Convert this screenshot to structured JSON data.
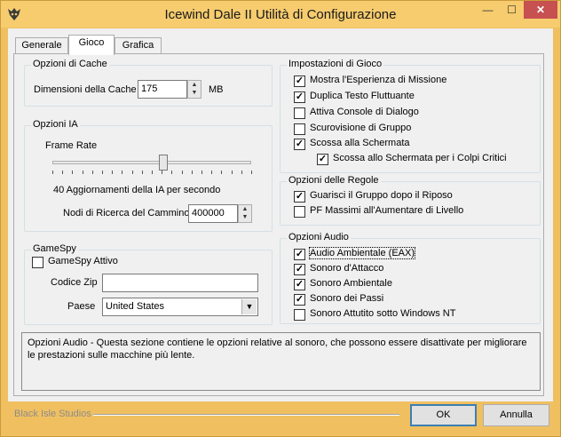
{
  "window": {
    "title": "Icewind Dale II Utilità di Configurazione"
  },
  "titlebar": {
    "minimize": "—",
    "maximize": "☐",
    "close": "✕"
  },
  "tabs": [
    {
      "label": "Generale",
      "active": false
    },
    {
      "label": "Gioco",
      "active": true
    },
    {
      "label": "Grafica",
      "active": false
    }
  ],
  "cache": {
    "title": "Opzioni di Cache",
    "size_label": "Dimensioni della Cache",
    "size_value": "175",
    "unit": "MB"
  },
  "ai": {
    "title": "Opzioni IA",
    "frame_rate_label": "Frame Rate",
    "updates_text": "40 Aggiornamenti della IA per secondo",
    "slider_fraction": 0.56,
    "pathfind_label": "Nodi di Ricerca del Cammino",
    "pathfind_value": "400000"
  },
  "gamespy": {
    "title": "GameSpy",
    "enabled_label": "GameSpy Attivo",
    "enabled": false,
    "zip_label": "Codice Zip",
    "zip_value": "",
    "country_label": "Paese",
    "country_value": "United States"
  },
  "game_settings": {
    "title": "Impostazioni di Gioco",
    "items": [
      {
        "label": "Mostra l'Esperienza di Missione",
        "checked": true
      },
      {
        "label": "Duplica Testo Fluttuante",
        "checked": true
      },
      {
        "label": "Attiva Console di Dialogo",
        "checked": false
      },
      {
        "label": "Scurovisione di Gruppo",
        "checked": false
      },
      {
        "label": "Scossa alla Schermata",
        "checked": true
      },
      {
        "label": "Scossa allo Schermata per i Colpi Critici",
        "checked": true
      }
    ]
  },
  "rules": {
    "title": "Opzioni delle Regole",
    "items": [
      {
        "label": "Guarisci il Gruppo dopo il Riposo",
        "checked": true
      },
      {
        "label": "PF Massimi all'Aumentare di Livello",
        "checked": false
      }
    ]
  },
  "audio": {
    "title": "Opzioni Audio",
    "items": [
      {
        "label": "Audio Ambientale (EAX)",
        "checked": true
      },
      {
        "label": "Sonoro d'Attacco",
        "checked": true
      },
      {
        "label": "Sonoro Ambientale",
        "checked": true
      },
      {
        "label": "Sonoro dei Passi",
        "checked": true
      },
      {
        "label": "Sonoro Attutito sotto Windows NT",
        "checked": false
      }
    ]
  },
  "description": {
    "text": "Opzioni Audio - Questa sezione contiene le opzioni relative al sonoro, che possono essere disattivate per migliorare le prestazioni sulle macchine più lente."
  },
  "footer": {
    "brand": "Black Isle Studios",
    "ok_label": "OK",
    "cancel_label": "Annulla"
  },
  "colors": {
    "titlebar": "#f6cc6e",
    "close_button": "#c75050",
    "default_border": "#3c7fb1"
  }
}
